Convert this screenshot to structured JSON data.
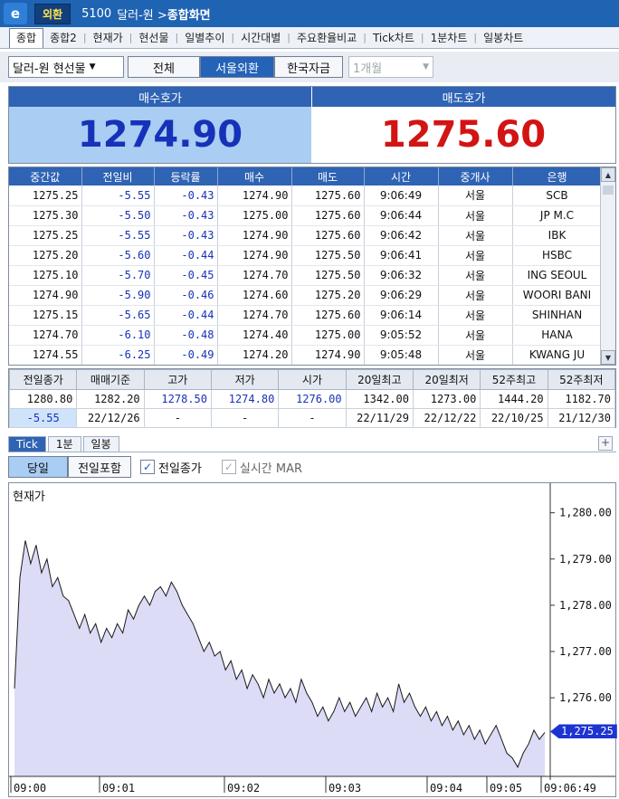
{
  "window": {
    "logo": "e",
    "category": "외환",
    "code": "5100",
    "path": "달러-원 >",
    "title": "종합화면"
  },
  "tabs": [
    "종합",
    "종합2",
    "현재가",
    "현선물",
    "일별추이",
    "시간대별",
    "주요환율비교",
    "Tick차트",
    "1분차트",
    "일봉차트"
  ],
  "toolbar": {
    "instrument": "달러-원 현선물",
    "filter_all": "전체",
    "filter_seoul": "서울외환",
    "filter_korea": "한국자금",
    "period": "1개월"
  },
  "quote": {
    "bid_label": "매수호가",
    "ask_label": "매도호가",
    "bid": "1274.90",
    "ask": "1275.60"
  },
  "tick_table": {
    "headers": [
      "중간값",
      "전일비",
      "등락률",
      "매수",
      "매도",
      "시간",
      "중개사",
      "은행"
    ],
    "rows": [
      [
        "1275.25",
        "-5.55",
        "-0.43",
        "1274.90",
        "1275.60",
        "9:06:49",
        "서울",
        "SCB"
      ],
      [
        "1275.30",
        "-5.50",
        "-0.43",
        "1275.00",
        "1275.60",
        "9:06:44",
        "서울",
        "JP M.C"
      ],
      [
        "1275.25",
        "-5.55",
        "-0.43",
        "1274.90",
        "1275.60",
        "9:06:42",
        "서울",
        "IBK"
      ],
      [
        "1275.20",
        "-5.60",
        "-0.44",
        "1274.90",
        "1275.50",
        "9:06:41",
        "서울",
        "HSBC"
      ],
      [
        "1275.10",
        "-5.70",
        "-0.45",
        "1274.70",
        "1275.50",
        "9:06:32",
        "서울",
        "ING SEOUL"
      ],
      [
        "1274.90",
        "-5.90",
        "-0.46",
        "1274.60",
        "1275.20",
        "9:06:29",
        "서울",
        "WOORI BANI"
      ],
      [
        "1275.15",
        "-5.65",
        "-0.44",
        "1274.70",
        "1275.60",
        "9:06:14",
        "서울",
        "SHINHAN"
      ],
      [
        "1274.70",
        "-6.10",
        "-0.48",
        "1274.40",
        "1275.00",
        "9:05:52",
        "서울",
        "HANA"
      ],
      [
        "1274.55",
        "-6.25",
        "-0.49",
        "1274.20",
        "1274.90",
        "9:05:48",
        "서울",
        "KWANG JU"
      ]
    ]
  },
  "stats": {
    "headers": [
      "전일종가",
      "매매기준",
      "고가",
      "저가",
      "시가",
      "20일최고",
      "20일최저",
      "52주최고",
      "52주최저"
    ],
    "values": [
      "1280.80",
      "1282.20",
      "1278.50",
      "1274.80",
      "1276.00",
      "1342.00",
      "1273.00",
      "1444.20",
      "1182.70"
    ],
    "second": [
      "-5.55",
      "22/12/26",
      "-",
      "-",
      "-",
      "22/11/29",
      "22/12/22",
      "22/10/25",
      "21/12/30"
    ]
  },
  "chart_tabs": [
    "Tick",
    "1분",
    "일봉"
  ],
  "chart_options": {
    "today": "당일",
    "include_prev": "전일포함",
    "prev_close_label": "전일종가",
    "mar_label": "실시간 MAR"
  },
  "chart_data": {
    "type": "area",
    "title": "현재가",
    "ylim": [
      1274.3,
      1280.6
    ],
    "y_ticks": [
      1280,
      1279,
      1278,
      1277,
      1276
    ],
    "y_tick_labels": [
      "1,280.00",
      "1,279.00",
      "1,278.00",
      "1,277.00",
      "1,276.00"
    ],
    "x_ticks": [
      "09:00",
      "09:01",
      "09:02",
      "09:03",
      "09:04",
      "09:05",
      "09:06:49"
    ],
    "last_price_label": "1,275.25",
    "colors": {
      "fill": "#dcdcf7",
      "line": "#1a1a1a",
      "flag": "#1e34d2"
    },
    "series": [
      {
        "values": [
          1276.2,
          1278.6,
          1279.4,
          1278.9,
          1279.3,
          1278.7,
          1279.0,
          1278.4,
          1278.6,
          1278.2,
          1278.1,
          1277.8,
          1277.5,
          1277.8,
          1277.4,
          1277.6,
          1277.2,
          1277.5,
          1277.3,
          1277.6,
          1277.4,
          1277.9,
          1277.7,
          1278.0,
          1278.2,
          1278.0,
          1278.3,
          1278.4,
          1278.2,
          1278.5,
          1278.3,
          1278.0,
          1277.8,
          1277.6,
          1277.3,
          1277.0,
          1277.2,
          1276.9,
          1277.0,
          1276.6,
          1276.8,
          1276.4,
          1276.6,
          1276.2,
          1276.5,
          1276.3,
          1276.0,
          1276.4,
          1276.1,
          1276.3,
          1276.0,
          1276.2,
          1275.9,
          1276.4,
          1276.1,
          1275.9,
          1275.6,
          1275.8,
          1275.5,
          1275.7,
          1276.0,
          1275.7,
          1275.9,
          1275.6,
          1275.8,
          1276.0,
          1275.7,
          1276.1,
          1275.8,
          1276.0,
          1275.7,
          1276.3,
          1275.9,
          1276.1,
          1275.8,
          1275.6,
          1275.8,
          1275.5,
          1275.7,
          1275.4,
          1275.6,
          1275.3,
          1275.5,
          1275.2,
          1275.4,
          1275.1,
          1275.3,
          1275.0,
          1275.2,
          1275.4,
          1275.1,
          1274.8,
          1274.7,
          1274.5,
          1274.8,
          1275.0,
          1275.3,
          1275.1,
          1275.25
        ]
      }
    ]
  }
}
